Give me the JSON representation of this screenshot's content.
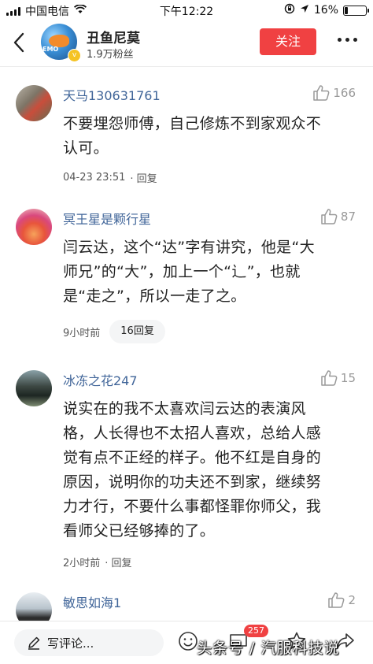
{
  "status_bar": {
    "carrier": "中国电信",
    "time": "下午12:22",
    "battery_text": "16%",
    "battery_level": 0.16
  },
  "header": {
    "name": "丑鱼尼莫",
    "fans": "1.9万粉丝",
    "follow_label": "关注",
    "avatar_text": "EMO"
  },
  "comments": [
    {
      "user": "天马130631761",
      "likes": "166",
      "text_lines": [
        "不要埋怨师傅，自己修炼不到家观众不",
        "认可。"
      ],
      "time": "04-23 23:51",
      "reply_label": "· 回复"
    },
    {
      "user": "冥王星是颗行星",
      "likes": "87",
      "text_lines": [
        "闫云达，这个“达”字有讲究，他是“大",
        "师兄”的“大”，加上一个“辶”，也就",
        "是“走之”，所以一走了之。"
      ],
      "time": "9小时前",
      "reply_label": "16回复"
    },
    {
      "user": "冰冻之花247",
      "likes": "15",
      "text_lines": [
        "说实在的我不太喜欢闫云达的表演风",
        "格，人长得也不太招人喜欢，总给人感",
        "觉有点不正经的样子。他不红是自身的",
        "原因，说明你的功夫还不到家，继续努",
        "力才行，不要什么事都怪罪你师父，我",
        "看师父已经够捧的了。"
      ],
      "time": "2小时前",
      "reply_label": "· 回复"
    },
    {
      "user": "敏思如海1",
      "likes": "2"
    }
  ],
  "bottom_bar": {
    "write_placeholder": "写评论...",
    "comment_count": "257"
  },
  "watermark": "头条号 / 汽服科技说",
  "colors": {
    "accent_red": "#f04142",
    "username_blue": "#406599"
  }
}
